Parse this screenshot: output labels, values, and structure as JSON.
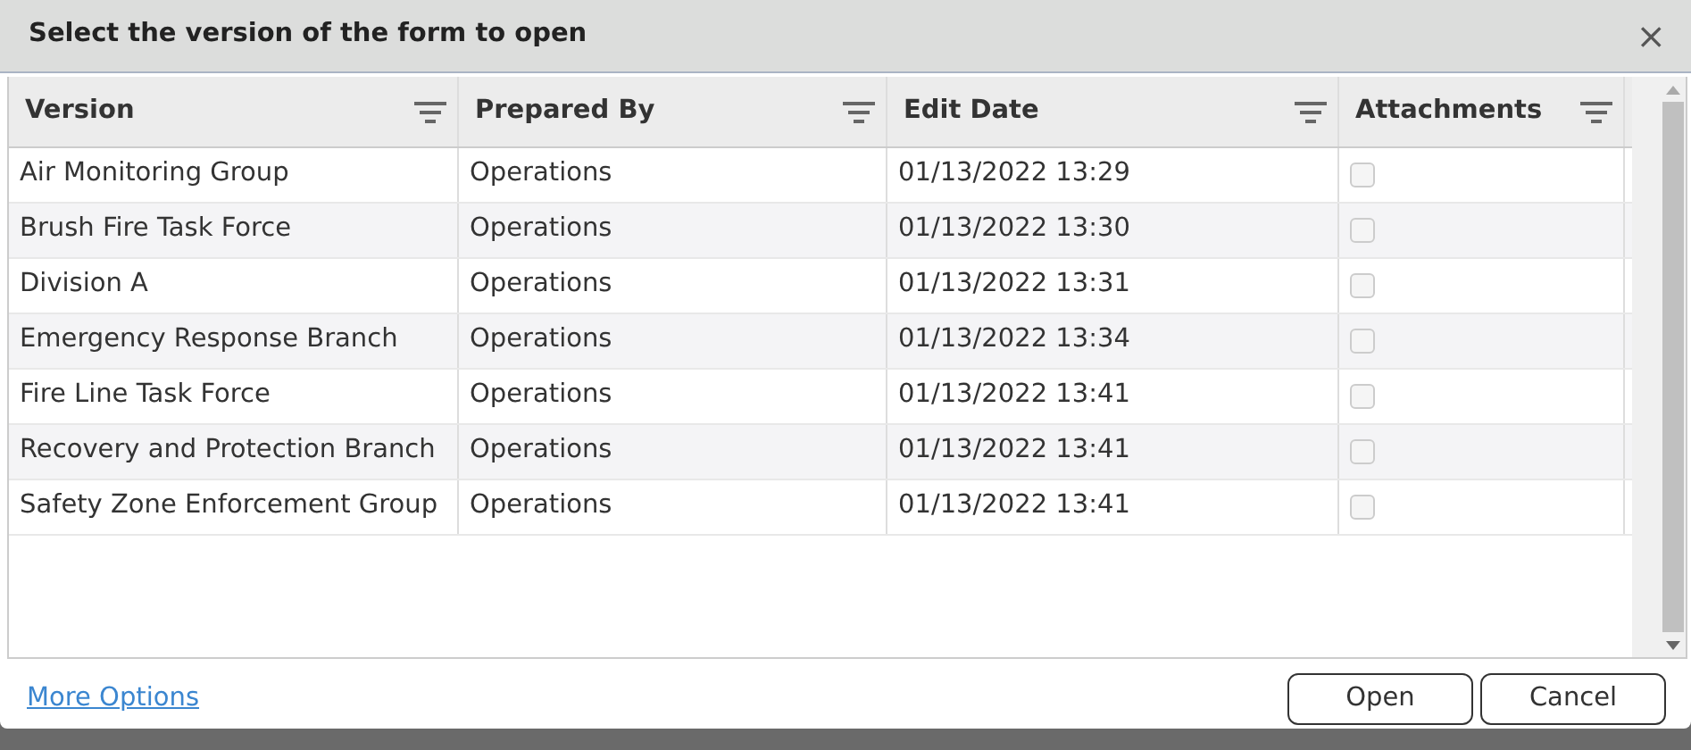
{
  "dialog": {
    "title": "Select the version of the form to open",
    "close": "×"
  },
  "table": {
    "columns": [
      "Version",
      "Prepared By",
      "Edit Date",
      "Attachments"
    ],
    "rows": [
      {
        "version": "Air Monitoring Group",
        "prepared_by": "Operations",
        "edit_date": "01/13/2022 13:29",
        "attachments": false
      },
      {
        "version": "Brush Fire Task Force",
        "prepared_by": "Operations",
        "edit_date": "01/13/2022 13:30",
        "attachments": false
      },
      {
        "version": "Division A",
        "prepared_by": "Operations",
        "edit_date": "01/13/2022 13:31",
        "attachments": false
      },
      {
        "version": "Emergency Response Branch",
        "prepared_by": "Operations",
        "edit_date": "01/13/2022 13:34",
        "attachments": false
      },
      {
        "version": "Fire Line Task Force",
        "prepared_by": "Operations",
        "edit_date": "01/13/2022 13:41",
        "attachments": false
      },
      {
        "version": "Recovery and Protection Branch",
        "prepared_by": "Operations",
        "edit_date": "01/13/2022 13:41",
        "attachments": false
      },
      {
        "version": "Safety Zone Enforcement Group",
        "prepared_by": "Operations",
        "edit_date": "01/13/2022 13:41",
        "attachments": false
      }
    ]
  },
  "footer": {
    "link": "More Options",
    "buttons": [
      "Open",
      "Cancel"
    ]
  }
}
